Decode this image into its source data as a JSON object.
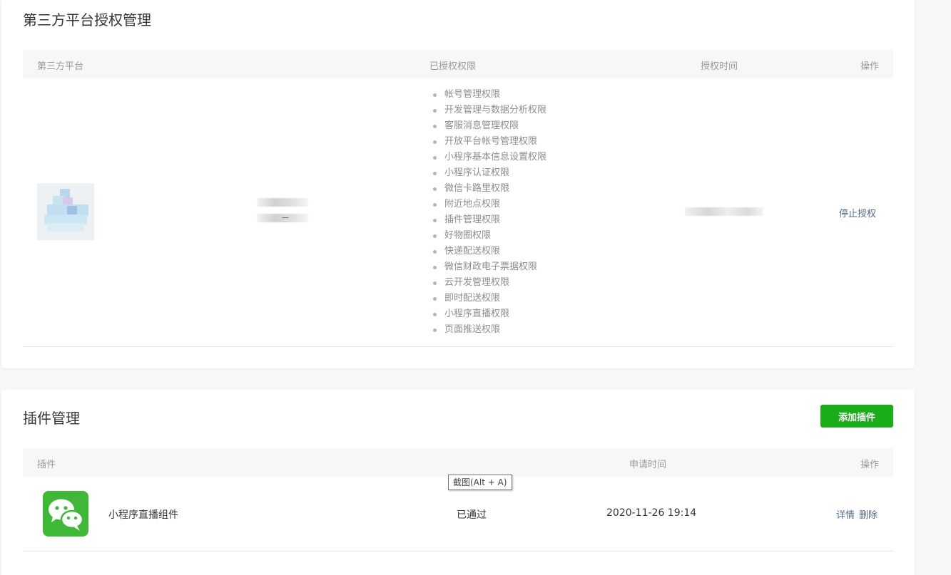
{
  "auth_section": {
    "title": "第三方平台授权管理",
    "columns": {
      "platform": "第三方平台",
      "permissions": "已授权权限",
      "time": "授权时间",
      "actions": "操作"
    },
    "row": {
      "name_partial": "ㄧ",
      "permissions": [
        "帐号管理权限",
        "开发管理与数据分析权限",
        "客服消息管理权限",
        "开放平台帐号管理权限",
        "小程序基本信息设置权限",
        "小程序认证权限",
        "微信卡路里权限",
        "附近地点权限",
        "插件管理权限",
        "好物圈权限",
        "快递配送权限",
        "微信财政电子票据权限",
        "云开发管理权限",
        "即时配送权限",
        "小程序直播权限",
        "页面推送权限"
      ],
      "action": "停止授权"
    }
  },
  "plugin_section": {
    "title": "插件管理",
    "add_button": "添加插件",
    "columns": {
      "plugin": "插件",
      "apply_time": "申请时间",
      "actions": "操作"
    },
    "row": {
      "icon": "wechat-icon",
      "name": "小程序直播组件",
      "status": "已通过",
      "time": "2020-11-26 19:14",
      "detail": "详情",
      "delete": "删除"
    }
  },
  "tooltip": "截图(Alt + A)",
  "colors": {
    "accent_green": "#1aad19",
    "link_blue": "#576b95",
    "wechat_green": "#3fb837"
  }
}
